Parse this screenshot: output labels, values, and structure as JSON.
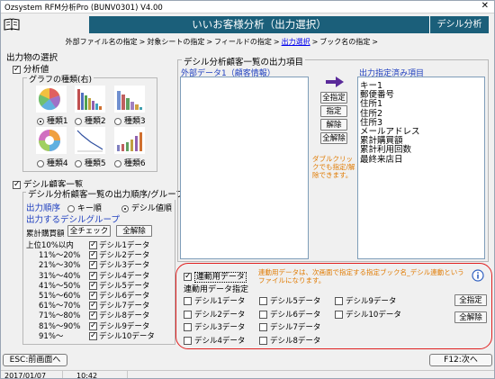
{
  "window_title": "Ozsystem RFM分析Pro (BUNV0301)  V4.00",
  "header": {
    "title": "いいお客様分析（出力選択）",
    "right": "デシル分析"
  },
  "breadcrumbs": [
    {
      "label": "外部ファイル名の指定",
      "current": false
    },
    {
      "label": "対象シートの指定",
      "current": false
    },
    {
      "label": "フィールドの指定",
      "current": false
    },
    {
      "label": "出力選択",
      "current": true
    },
    {
      "label": "ブック名の指定",
      "current": false
    }
  ],
  "output_selection_label": "出力物の選択",
  "distribution": {
    "checkbox_label": "分析値",
    "checked": true,
    "graph_group_title": "グラフの種類(右)",
    "graph_types": [
      {
        "label": "種類1",
        "selected": true
      },
      {
        "label": "種類2",
        "selected": false
      },
      {
        "label": "種類3",
        "selected": false
      },
      {
        "label": "種類4",
        "selected": false
      },
      {
        "label": "種類5",
        "selected": false
      },
      {
        "label": "種類6",
        "selected": false
      }
    ]
  },
  "decile_list": {
    "checkbox_label": "デシル顧客一覧",
    "checked": true,
    "group_title": "デシル分析顧客一覧の出力順序/グループ",
    "order_label": "出力順序",
    "order_options": [
      {
        "label": "キー順",
        "selected": false
      },
      {
        "label": "デシル値順",
        "selected": true
      }
    ],
    "output_groups_label": "出力するデシルグループ",
    "cumulative_label": "累計購買額",
    "check_all": "全チェック",
    "uncheck_all": "全解除",
    "ranges": [
      "上位10%以内",
      "11%〜20%",
      "21%〜30%",
      "31%〜40%",
      "41%〜50%",
      "51%〜60%",
      "61%〜70%",
      "71%〜80%",
      "81%〜90%",
      "91%〜"
    ],
    "groups": [
      {
        "label": "デシル1データ",
        "checked": true
      },
      {
        "label": "デシル2データ",
        "checked": true
      },
      {
        "label": "デシル3データ",
        "checked": true
      },
      {
        "label": "デシル4データ",
        "checked": true
      },
      {
        "label": "デシル5データ",
        "checked": true
      },
      {
        "label": "デシル6データ",
        "checked": true
      },
      {
        "label": "デシル7データ",
        "checked": true
      },
      {
        "label": "デシル8データ",
        "checked": true
      },
      {
        "label": "デシル9データ",
        "checked": true
      },
      {
        "label": "デシル10データ",
        "checked": true
      }
    ]
  },
  "output_items": {
    "group_title": "デシル分析顧客一覧の出力項目",
    "source_label": "外部データ1（顧客情報）",
    "target_label": "出力指定済み項目",
    "buttons": {
      "select_all": "全指定",
      "select": "指定",
      "remove": "解除",
      "remove_all": "全解除"
    },
    "hint": "ダブルクリックでも指定/解除できます。",
    "selected_items": [
      "キー1",
      "郵便番号",
      "住所1",
      "住所2",
      "住所3",
      "メールアドレス",
      "累計購買額",
      "累計利用回数",
      "最終来店日"
    ]
  },
  "linked": {
    "checkbox_label": "連動用データ",
    "checked": true,
    "note": "連動用データは、次画面で指定する指定ブック名_デシル連動というファイルになります。",
    "spec_label": "連動用データ指定",
    "items": [
      {
        "label": "デシル1データ",
        "checked": false
      },
      {
        "label": "デシル2データ",
        "checked": false
      },
      {
        "label": "デシル3データ",
        "checked": false
      },
      {
        "label": "デシル4データ",
        "checked": false
      },
      {
        "label": "デシル5データ",
        "checked": false
      },
      {
        "label": "デシル6データ",
        "checked": false
      },
      {
        "label": "デシル7データ",
        "checked": false
      },
      {
        "label": "デシル8データ",
        "checked": false
      },
      {
        "label": "デシル9データ",
        "checked": false
      },
      {
        "label": "デシル10データ",
        "checked": false
      }
    ],
    "select_all": "全指定",
    "remove_all": "全解除"
  },
  "footer": {
    "back": "ESC:前画面へ",
    "next": "F12:次へ"
  },
  "status": {
    "date": "2017/01/07",
    "time": "10:42"
  }
}
